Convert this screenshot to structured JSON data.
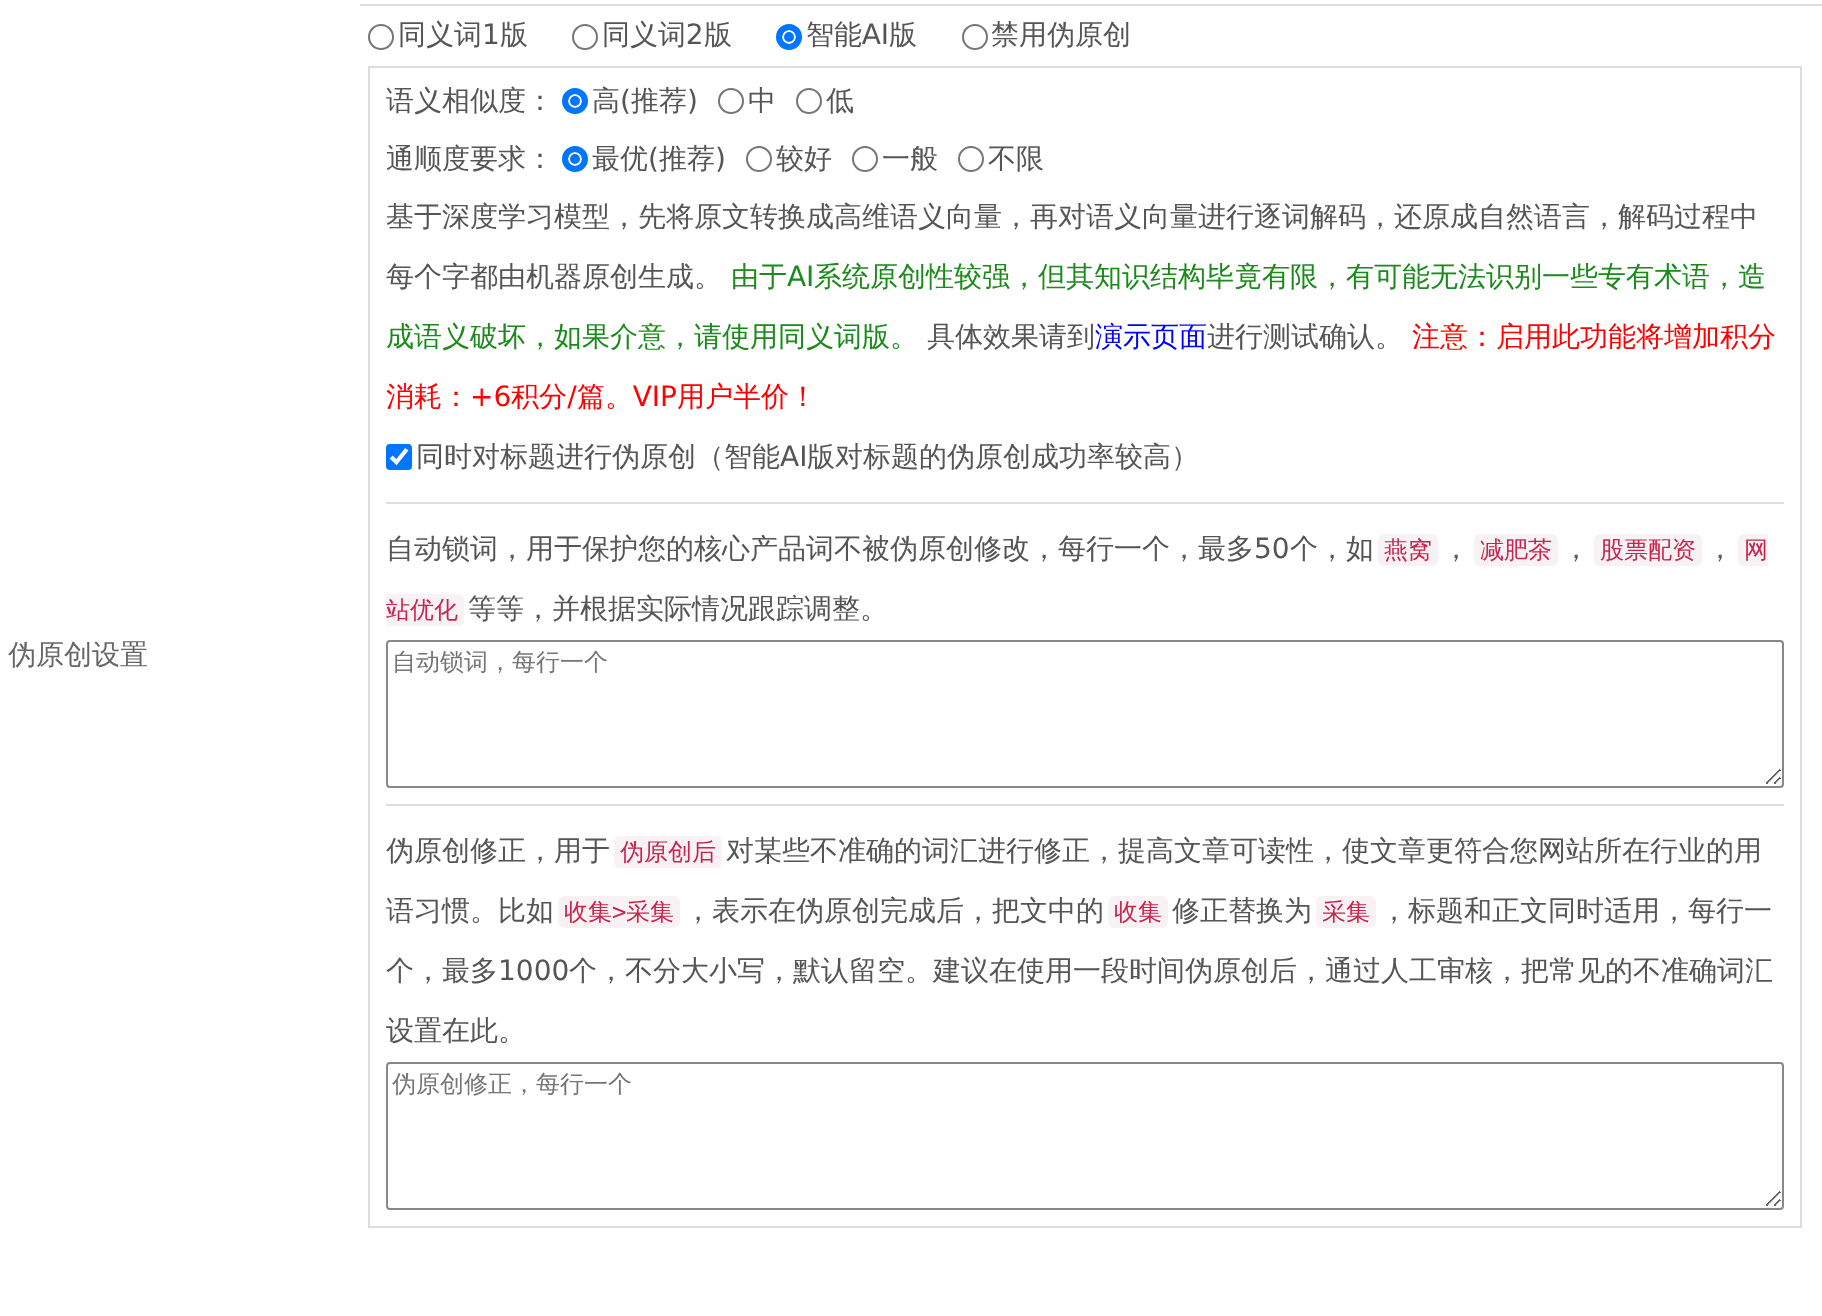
{
  "section_label": "伪原创设置",
  "mode_options": [
    {
      "label": "同义词1版",
      "selected": false
    },
    {
      "label": "同义词2版",
      "selected": false
    },
    {
      "label": "智能AI版",
      "selected": true
    },
    {
      "label": "禁用伪原创",
      "selected": false
    }
  ],
  "settings": [
    {
      "label": "语义相似度：",
      "options": [
        {
          "label": "高(推荐)",
          "selected": true
        },
        {
          "label": "中",
          "selected": false
        },
        {
          "label": "低",
          "selected": false
        }
      ]
    },
    {
      "label": "通顺度要求：",
      "options": [
        {
          "label": "最优(推荐)",
          "selected": true
        },
        {
          "label": "较好",
          "selected": false
        },
        {
          "label": "一般",
          "selected": false
        },
        {
          "label": "不限",
          "selected": false
        }
      ]
    }
  ],
  "description": [
    {
      "kind": "text",
      "text": "基于深度学习模型，先将原文转换成高维语义向量，再对语义向量进行逐词解码，还原成自然语言，解码过程中每个字都由机器原创生成。 "
    },
    {
      "kind": "note",
      "text": "由于AI系统原创性较强，但其知识结构毕竟有限，有可能无法识别一些专有术语，造成语义破坏，如果介意，请使用同义词版。"
    },
    {
      "kind": "text",
      "text": " 具体效果请到"
    },
    {
      "kind": "link",
      "text": "演示页面"
    },
    {
      "kind": "text",
      "text": "进行测试确认。 "
    },
    {
      "kind": "warning",
      "text": "注意：启用此功能将增加积分消耗：+6积分/篇。VIP用户半价！"
    }
  ],
  "title_option": {
    "label": "同时对标题进行伪原创（智能AI版对标题的伪原创成功率较高）",
    "checked": true
  },
  "lock_words": {
    "description": [
      {
        "kind": "text",
        "text": "自动锁词，用于保护您的核心产品词不被伪原创修改，每行一个，最多50个，如"
      },
      {
        "kind": "code",
        "text": "燕窝"
      },
      {
        "kind": "text",
        "text": "，"
      },
      {
        "kind": "code",
        "text": "减肥茶"
      },
      {
        "kind": "text",
        "text": "，"
      },
      {
        "kind": "code",
        "text": "股票配资"
      },
      {
        "kind": "text",
        "text": "，"
      },
      {
        "kind": "code",
        "text": "网站优化"
      },
      {
        "kind": "text",
        "text": "等等，并根据实际情况跟踪调整。"
      }
    ],
    "placeholder": "自动锁词，每行一个"
  },
  "corrections": {
    "description": [
      {
        "kind": "text",
        "text": "伪原创修正，用于"
      },
      {
        "kind": "code",
        "text": "伪原创后"
      },
      {
        "kind": "text",
        "text": "对某些不准确的词汇进行修正，提高文章可读性，使文章更符合您网站所在行业的用语习惯。比如"
      },
      {
        "kind": "code",
        "text": "收集>采集"
      },
      {
        "kind": "text",
        "text": "，表示在伪原创完成后，把文中的"
      },
      {
        "kind": "code",
        "text": "收集"
      },
      {
        "kind": "text",
        "text": "修正替换为"
      },
      {
        "kind": "code",
        "text": "采集"
      },
      {
        "kind": "text",
        "text": "，标题和正文同时适用，每行一个，最多1000个，不分大小写，默认留空。建议在使用一段时间伪原创后，通过人工审核，把常见的不准确词汇设置在此。"
      }
    ],
    "placeholder": "伪原创修正，每行一个"
  }
}
